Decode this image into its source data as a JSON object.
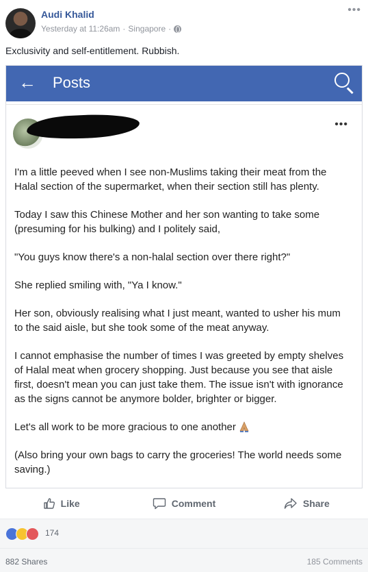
{
  "post": {
    "author": "Audi Khalid",
    "timestamp": "Yesterday at 11:26am",
    "location": "Singapore",
    "privacy_icon": "globe-icon",
    "caption": "Exclusivity and self-entitlement. Rubbish."
  },
  "embedded": {
    "bar_title": "Posts",
    "bar_color": "#4267b2",
    "paragraphs": [
      "I'm a little peeved when I see non-Muslims taking their meat from the Halal section of the supermarket, when their section still has plenty.",
      "Today I saw this Chinese Mother and her son wanting to take some (presuming for his bulking) and I politely said,",
      "\"You guys know there's a non-halal section over there right?\"",
      "She replied smiling with, \"Ya I know.\"",
      "Her son, obviously realising what I just meant, wanted to usher his mum to the said aisle, but she took some of the meat anyway.",
      "I cannot emphasise the number of times I was greeted by empty shelves of Halal meat when grocery shopping. Just because you see that aisle first, doesn't mean you can just take them. The issue isn't with ignorance as the signs cannot be anymore bolder, brighter or bigger.",
      "Let's all work to be more gracious to one another",
      "(Also bring your own bags to carry the groceries! The world needs some saving.)"
    ]
  },
  "actions": {
    "like": "Like",
    "comment": "Comment",
    "share": "Share"
  },
  "stats": {
    "reactions_count": "174",
    "shares": "882 Shares",
    "comments": "185 Comments"
  },
  "colors": {
    "link_blue": "#365899",
    "muted": "#90949c"
  }
}
